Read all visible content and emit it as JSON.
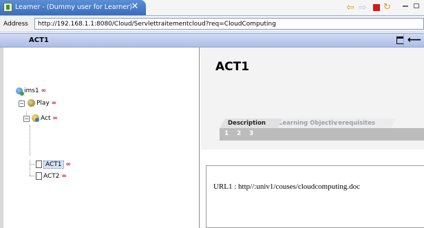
{
  "window": {
    "tab_title": "Learner - (Dummy user for Learner)",
    "close_glyph": "✕"
  },
  "toolbar": {
    "icons": [
      "back-arrow-icon",
      "forward-arrow-icon",
      "stop-icon",
      "refresh-icon",
      "minimize-icon",
      "maximize-icon"
    ]
  },
  "address": {
    "label": "Address",
    "value": "http://192.168.1.1:8080/Cloud/Servlettraitementcloud?req=CloudComputing"
  },
  "header": {
    "title": "ACT1"
  },
  "tree": {
    "nodes": [
      {
        "label": "ims1",
        "icon": "ims-icon"
      },
      {
        "label": "Play",
        "icon": "play-icon"
      },
      {
        "label": "Act",
        "icon": "act-icon"
      },
      {
        "label": "ACT1",
        "icon": "document-icon",
        "selected": true
      },
      {
        "label": "ACT2",
        "icon": "document-icon"
      }
    ],
    "infinity_glyph": "∞"
  },
  "content": {
    "title": "ACT1",
    "tabs": [
      "Description",
      "Learning Objectives",
      "Prerequisites"
    ],
    "active_tab": "Description",
    "sub_items": [
      "1",
      "2",
      "3"
    ],
    "body_text": "URL1 : http//:univ1/couses/cloudcomputing.doc"
  },
  "colors": {
    "tab_blue": "#3a6cba",
    "header_band": "#aebde6",
    "infinity_red": "#d11a1a",
    "subbar_gray": "#bcbcbc"
  }
}
